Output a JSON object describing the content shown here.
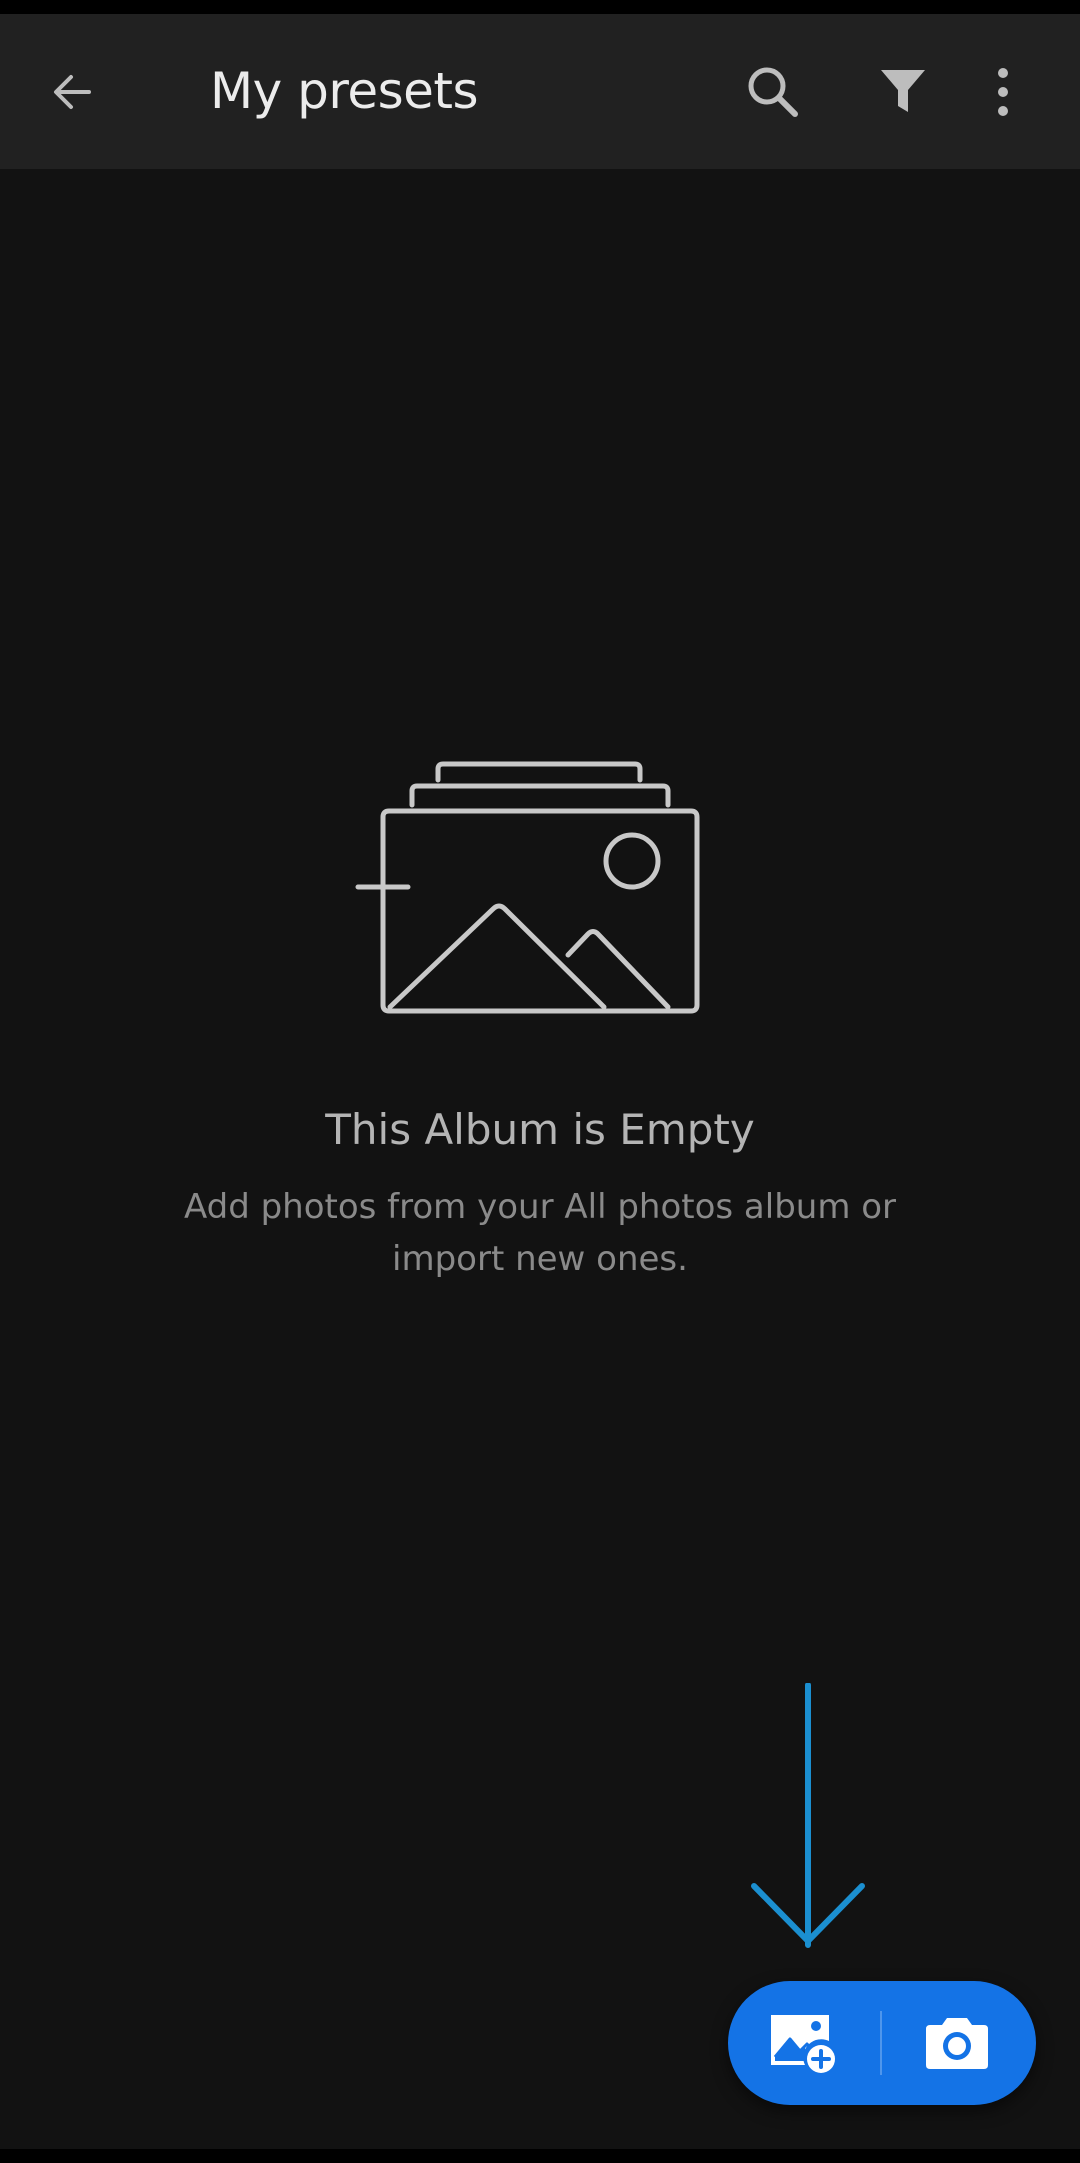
{
  "app_bar": {
    "title": "My presets",
    "back_icon": "arrow-left-icon",
    "search_icon": "search-icon",
    "filter_icon": "filter-icon",
    "more_icon": "more-vertical-icon"
  },
  "empty_state": {
    "illustration_icon": "empty-album-icon",
    "title": "This Album is Empty",
    "description": "Add photos from your All photos album or import new ones."
  },
  "fab": {
    "add_photos_icon": "add-photo-icon",
    "camera_icon": "camera-icon",
    "color": "#1473e6"
  },
  "hint_arrow_color": "#1b8fd0"
}
